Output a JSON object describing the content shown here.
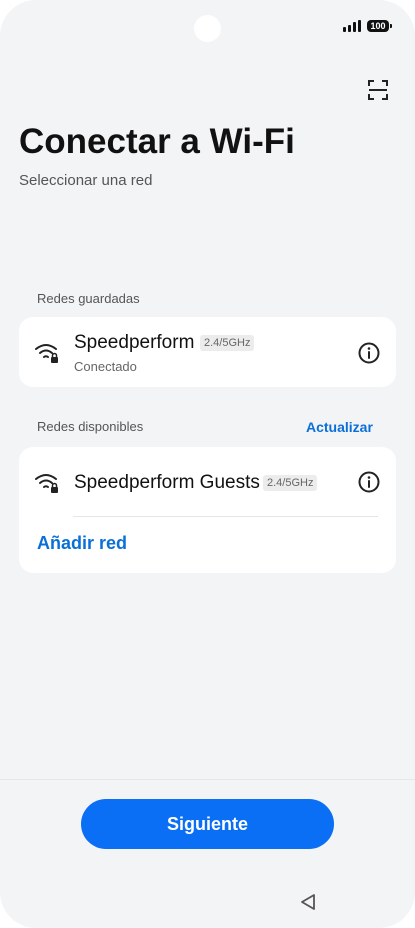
{
  "status_bar": {
    "battery": "100",
    "icons": [
      "signal-icon",
      "battery-icon"
    ]
  },
  "header": {
    "scan_icon": "qr-scan-icon",
    "title": "Conectar a Wi-Fi",
    "subtitle": "Seleccionar una red"
  },
  "saved": {
    "label": "Redes guardadas",
    "network": {
      "name": "Speedperform",
      "band": "2.4/5GHz",
      "status": "Conectado",
      "icon": "wifi-locked-icon"
    }
  },
  "available": {
    "label": "Redes disponibles",
    "refresh_label": "Actualizar",
    "networks": [
      {
        "name": "Speedperform Guests",
        "band": "2.4/5GHz",
        "icon": "wifi-locked-icon"
      }
    ],
    "add_label": "Añadir red"
  },
  "footer": {
    "next_label": "Siguiente",
    "nav_icon": "back-triangle-icon"
  },
  "colors": {
    "accent": "#0a6ff5",
    "link": "#0a6fd8",
    "background": "#f3f4f6",
    "card": "#ffffff"
  }
}
